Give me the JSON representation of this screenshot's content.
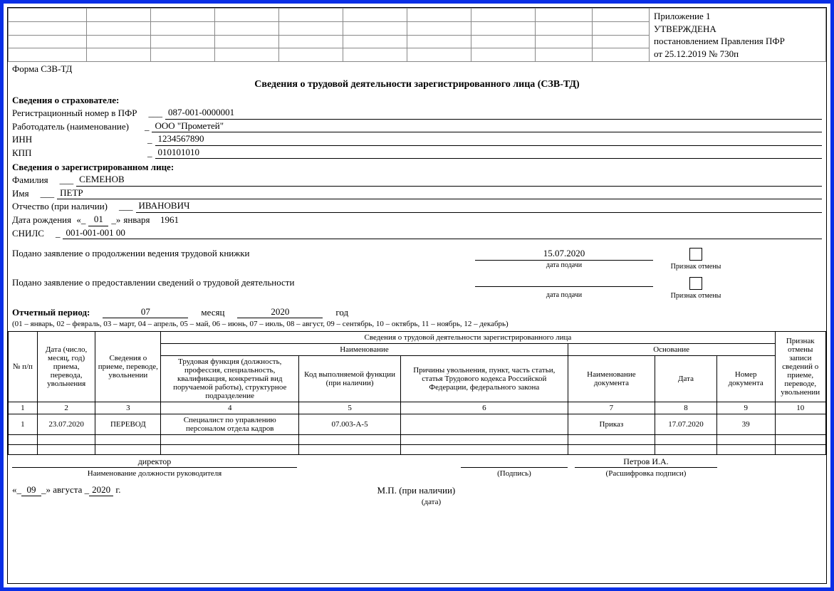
{
  "appendix": {
    "line1": "Приложение 1",
    "line2": "УТВЕРЖДЕНА",
    "line3": "постановлением Правления ПФР",
    "line4": "от 25.12.2019  № 730п"
  },
  "formCode": "Форма СЗВ-ТД",
  "title": "Сведения о трудовой деятельности зарегистрированного лица (СЗВ-ТД)",
  "insurer": {
    "header": "Сведения о страхователе:",
    "regLabel": "Регистрационный номер в ПФР",
    "regPrefix": "___",
    "regValue": "087-001-0000001",
    "employerLabel": "Работодатель (наименование)",
    "employerPrefix": "_",
    "employerValue": "ООО \"Прометей\"",
    "innLabel": "ИНН",
    "innPrefix": "_",
    "innValue": "1234567890",
    "kppLabel": "КПП",
    "kppPrefix": "_",
    "kppValue": "010101010"
  },
  "person": {
    "header": "Сведения о зарегистрированном лице:",
    "surnameLabel": "Фамилия",
    "surnamePrefix": "___",
    "surname": "СЕМЕНОВ",
    "nameLabel": "Имя",
    "namePrefix": "___",
    "name": "ПЕТР",
    "patronymicLabel": "Отчество (при наличии)",
    "patronymicPrefix": "___",
    "patronymic": "ИВАНОВИЧ",
    "dobLabel": "Дата рождения",
    "dobDay": "01",
    "dobMonth": "января",
    "dobYear": "1961",
    "snilsLabel": "СНИЛС",
    "snilsPrefix": "_",
    "snils": "001-001-001 00"
  },
  "statements": {
    "s1": "Подано заявление о продолжении ведения трудовой книжки",
    "s1date": "15.07.2020",
    "s2": "Подано заявление о предоставлении сведений о трудовой деятельности",
    "s2date": "",
    "dateCaption": "дата подачи",
    "cancelCaption": "Признак отмены"
  },
  "period": {
    "label": "Отчетный период:",
    "month": "07",
    "monthLabel": "месяц",
    "year": "2020",
    "yearLabel": "год",
    "note": "(01 – январь, 02 – февраль, 03 – март, 04 – апрель, 05 – май, 06 – июнь, 07 – июль, 08 – август, 09 – сентябрь, 10 – октябрь, 11 – ноябрь, 12 – декабрь)"
  },
  "table": {
    "super": "Сведения о трудовой деятельности зарегистрированного лица",
    "h_no": "№ п/п",
    "h_date": "Дата (число, месяц, год) приема, перевода, увольнения",
    "h_info": "Сведения о приеме, переводе, увольнении",
    "h_naming": "Наименование",
    "h_func": "Трудовая функция (должность, профессия, специальность, квалификация, конкретный вид поручаемой работы), структурное подразделение",
    "h_code": "Код выполняемой функции (при наличии)",
    "h_reason": "Причины увольнения, пункт, часть статьи, статья Трудового кодекса Российской Федерации, федерального закона",
    "h_basis": "Основание",
    "h_docname": "Наименование документа",
    "h_docdate": "Дата",
    "h_docnum": "Номер документа",
    "h_cancel": "Признак отмены записи сведений о приеме, переводе, увольнении",
    "c1": "1",
    "c2": "2",
    "c3": "3",
    "c4": "4",
    "c5": "5",
    "c6": "6",
    "c7": "7",
    "c8": "8",
    "c9": "9",
    "c10": "10",
    "row": {
      "no": "1",
      "date": "23.07.2020",
      "info": "ПЕРЕВОД",
      "func": "Специалист по управлению персоналом отдела кадров",
      "code": "07.003-А-5",
      "reason": "",
      "docname": "Приказ",
      "docdate": "17.07.2020",
      "docnum": "39",
      "cancel": ""
    }
  },
  "sign": {
    "position": "директор",
    "positionCaption": "Наименование должности руководителя",
    "signCaption": "(Подпись)",
    "name": "Петров И.А.",
    "nameCaption": "(Расшифровка подписи)"
  },
  "footer": {
    "datePrefix": "«_",
    "dateDay": "09",
    "dateMid": "_» августа _",
    "dateYear": "2020",
    "dateSuffix": " г.",
    "dateCaption": "(дата)",
    "mp": "М.П. (при наличии)"
  }
}
